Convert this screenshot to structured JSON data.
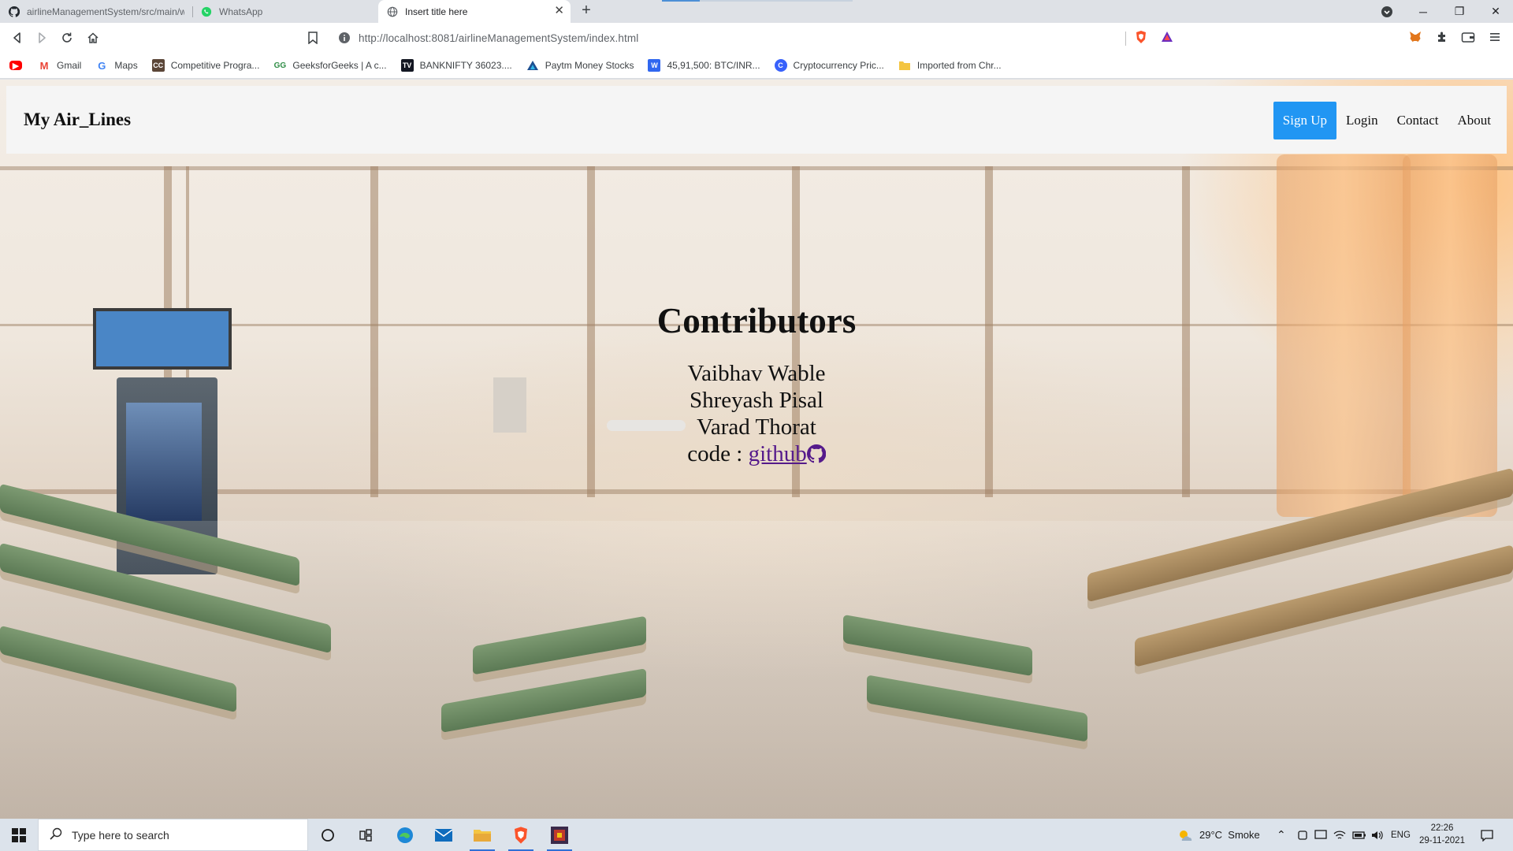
{
  "browser": {
    "tabs": [
      {
        "title": "airlineManagementSystem/src/main/w",
        "icon": "github-icon",
        "active": false
      },
      {
        "title": "WhatsApp",
        "icon": "whatsapp-icon",
        "active": false
      },
      {
        "title": "Insert title here",
        "icon": "globe-icon",
        "active": true
      }
    ],
    "address_url": "http://localhost:8081/airlineManagementSystem/index.html",
    "bookmarks": [
      {
        "label": "",
        "icon": "youtube-icon",
        "color": "#ff0000"
      },
      {
        "label": "Gmail",
        "icon": "gmail-icon",
        "color": "#ea4335"
      },
      {
        "label": "Maps",
        "icon": "google-icon",
        "color": "#4285f4"
      },
      {
        "label": "Competitive Progra...",
        "icon": "codechef-icon",
        "color": "#5b4638"
      },
      {
        "label": "GeeksforGeeks | A c...",
        "icon": "geeksforgeeks-icon",
        "color": "#2f8d46"
      },
      {
        "label": "BANKNIFTY 36023....",
        "icon": "tradingview-icon",
        "color": "#131722"
      },
      {
        "label": "Paytm Money Stocks",
        "icon": "paytm-money-icon",
        "color": "#1d4f91"
      },
      {
        "label": "45,91,500: BTC/INR...",
        "icon": "wazirx-icon",
        "color": "#3067f0"
      },
      {
        "label": "Cryptocurrency Pric...",
        "icon": "coinmarketcap-icon",
        "color": "#3861fb"
      },
      {
        "label": "Imported from Chr...",
        "icon": "folder-icon",
        "color": "#f4c542"
      }
    ]
  },
  "site": {
    "brand": "My Air_Lines",
    "nav": [
      {
        "label": "Sign Up",
        "primary": true
      },
      {
        "label": "Login",
        "primary": false
      },
      {
        "label": "Contact",
        "primary": false
      },
      {
        "label": "About",
        "primary": false
      }
    ],
    "contributors_title": "Contributors",
    "contributors": [
      "Vaibhav Wable",
      "Shreyash Pisal",
      "Varad Thorat"
    ],
    "code_prefix": "code :",
    "code_link_label": "github",
    "accent_color": "#2196f3"
  },
  "taskbar": {
    "search_placeholder": "Type here to search",
    "weather": "29°C  Smoke",
    "language": "ENG",
    "time": "22:26",
    "date": "29-11-2021"
  }
}
